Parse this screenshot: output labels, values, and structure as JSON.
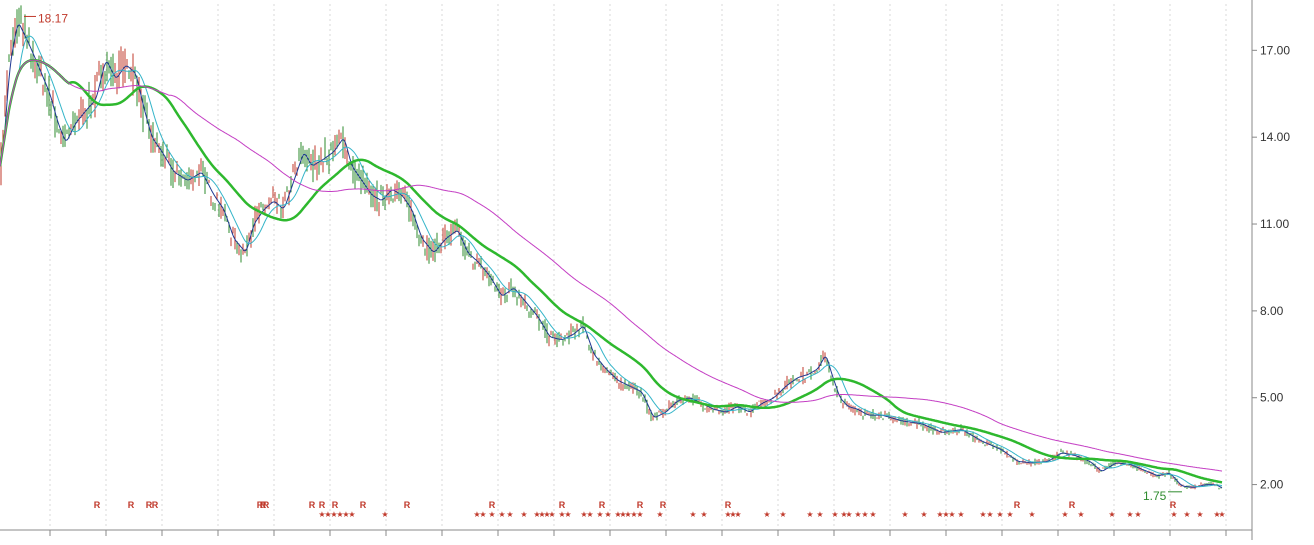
{
  "chart_data": {
    "type": "candlestick",
    "title": "",
    "xlabel": "",
    "ylabel": "",
    "ylim": [
      0.5,
      18.6
    ],
    "y_ticks": [
      "2.00",
      "5.00",
      "8.00",
      "11.00",
      "14.00",
      "17.00"
    ],
    "y_tick_values": [
      2,
      5,
      8,
      11,
      14,
      17
    ],
    "grid": "vertical dashed",
    "annotations": {
      "high_label": "18.17",
      "high_value": 18.17,
      "low_label": "1.75",
      "low_value": 1.75
    },
    "price_anchors": [
      [
        0,
        13.0
      ],
      [
        8,
        16.5
      ],
      [
        16,
        18.0
      ],
      [
        26,
        17.3
      ],
      [
        36,
        16.5
      ],
      [
        48,
        15.5
      ],
      [
        56,
        14.5
      ],
      [
        64,
        13.8
      ],
      [
        74,
        14.5
      ],
      [
        86,
        15.0
      ],
      [
        94,
        15.3
      ],
      [
        104,
        16.7
      ],
      [
        114,
        16.0
      ],
      [
        124,
        16.5
      ],
      [
        134,
        16.2
      ],
      [
        142,
        15.0
      ],
      [
        150,
        14.0
      ],
      [
        160,
        13.5
      ],
      [
        172,
        12.8
      ],
      [
        186,
        12.5
      ],
      [
        200,
        12.8
      ],
      [
        212,
        12.0
      ],
      [
        222,
        11.5
      ],
      [
        232,
        10.5
      ],
      [
        244,
        10.0
      ],
      [
        252,
        11.0
      ],
      [
        262,
        11.5
      ],
      [
        272,
        11.8
      ],
      [
        282,
        11.5
      ],
      [
        292,
        12.5
      ],
      [
        302,
        13.5
      ],
      [
        310,
        13.0
      ],
      [
        320,
        13.2
      ],
      [
        332,
        13.5
      ],
      [
        342,
        14.0
      ],
      [
        350,
        13.0
      ],
      [
        360,
        12.5
      ],
      [
        370,
        12.0
      ],
      [
        380,
        11.8
      ],
      [
        390,
        12.2
      ],
      [
        400,
        12.0
      ],
      [
        410,
        11.5
      ],
      [
        420,
        10.5
      ],
      [
        432,
        10.0
      ],
      [
        444,
        10.5
      ],
      [
        456,
        10.8
      ],
      [
        466,
        10.0
      ],
      [
        476,
        9.7
      ],
      [
        488,
        9.2
      ],
      [
        500,
        8.5
      ],
      [
        512,
        8.8
      ],
      [
        524,
        8.3
      ],
      [
        536,
        7.8
      ],
      [
        548,
        7.1
      ],
      [
        560,
        7.0
      ],
      [
        572,
        7.2
      ],
      [
        582,
        7.5
      ],
      [
        592,
        6.5
      ],
      [
        604,
        6.0
      ],
      [
        616,
        5.6
      ],
      [
        628,
        5.4
      ],
      [
        640,
        5.2
      ],
      [
        652,
        4.3
      ],
      [
        664,
        4.5
      ],
      [
        676,
        4.9
      ],
      [
        688,
        5.0
      ],
      [
        700,
        4.8
      ],
      [
        712,
        4.6
      ],
      [
        724,
        4.5
      ],
      [
        736,
        4.7
      ],
      [
        748,
        4.5
      ],
      [
        760,
        4.8
      ],
      [
        772,
        5.0
      ],
      [
        784,
        5.4
      ],
      [
        796,
        5.7
      ],
      [
        806,
        5.8
      ],
      [
        816,
        6.0
      ],
      [
        824,
        6.5
      ],
      [
        830,
        5.8
      ],
      [
        838,
        5.0
      ],
      [
        846,
        4.7
      ],
      [
        856,
        4.6
      ],
      [
        866,
        4.4
      ],
      [
        880,
        4.4
      ],
      [
        900,
        4.2
      ],
      [
        920,
        4.1
      ],
      [
        940,
        3.8
      ],
      [
        960,
        3.9
      ],
      [
        980,
        3.5
      ],
      [
        1000,
        3.2
      ],
      [
        1016,
        2.8
      ],
      [
        1030,
        2.75
      ],
      [
        1046,
        2.8
      ],
      [
        1060,
        3.1
      ],
      [
        1074,
        3.0
      ],
      [
        1088,
        2.8
      ],
      [
        1100,
        2.45
      ],
      [
        1114,
        2.75
      ],
      [
        1128,
        2.7
      ],
      [
        1142,
        2.5
      ],
      [
        1156,
        2.3
      ],
      [
        1168,
        2.4
      ],
      [
        1180,
        1.95
      ],
      [
        1192,
        1.9
      ],
      [
        1204,
        2.0
      ],
      [
        1214,
        2.0
      ],
      [
        1222,
        1.85
      ]
    ],
    "series": [
      {
        "name": "",
        "color": "#1f3a93",
        "kind": "ma",
        "window": 5
      },
      {
        "name": "",
        "color": "#35b5c9",
        "kind": "ma",
        "window": 20
      },
      {
        "name": "",
        "color": "#2eb82e",
        "kind": "ma",
        "window": 70
      },
      {
        "name": "",
        "color": "#c43fc4",
        "kind": "ma",
        "window": 170
      }
    ],
    "candle_colors": {
      "up": "#c0392b",
      "down": "#2e8b2e"
    },
    "signal_marks": {
      "r_text": "R",
      "star_text": "★",
      "r_positions": [
        97,
        131,
        149,
        155,
        260,
        263,
        266,
        312,
        322,
        335,
        363,
        407,
        492,
        562,
        602,
        640,
        663,
        728,
        1017,
        1072,
        1173
      ],
      "star_positions": [
        322,
        328,
        334,
        340,
        346,
        352,
        385,
        477,
        483,
        492,
        502,
        510,
        524,
        537,
        542,
        547,
        552,
        562,
        568,
        584,
        590,
        600,
        608,
        618,
        623,
        628,
        634,
        640,
        660,
        693,
        704,
        728,
        733,
        738,
        767,
        783,
        810,
        820,
        835,
        844,
        849,
        858,
        865,
        873,
        905,
        924,
        940,
        946,
        952,
        961,
        983,
        990,
        1000,
        1010,
        1032,
        1065,
        1081,
        1112,
        1130,
        1138,
        1174,
        1187,
        1200,
        1217,
        1222
      ]
    }
  }
}
